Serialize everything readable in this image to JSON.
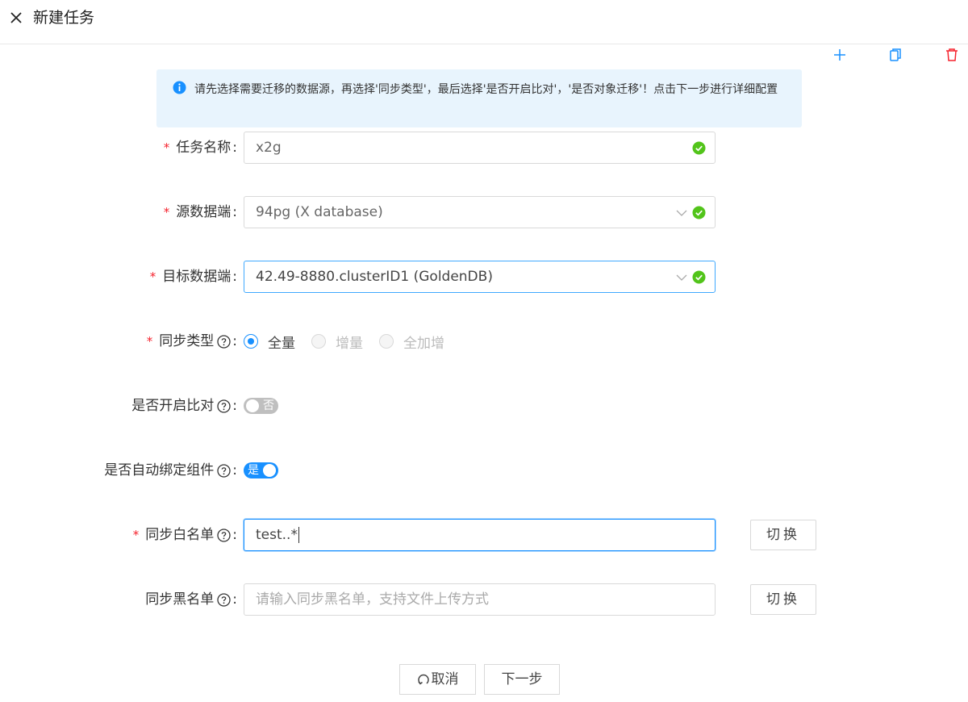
{
  "header": {
    "title": "新建任务"
  },
  "toolbar": {
    "icons": [
      "plus-icon",
      "copy-icon",
      "delete-icon"
    ],
    "delete_color": "#f5222d",
    "accent": "#1890ff"
  },
  "alert": {
    "text": "请先选择需要迁移的数据源，再选择'同步类型'，最后选择'是否开启比对'，'是否对象迁移'！点击下一步进行详细配置"
  },
  "form": {
    "task_name": {
      "label": "任务名称",
      "value": "x2g"
    },
    "source": {
      "label": "源数据端",
      "value": "94pg (X database)"
    },
    "target": {
      "label": "目标数据端",
      "value": "42.49-8880.clusterID1 (GoldenDB)"
    },
    "sync_type": {
      "label": "同步类型",
      "options": [
        "全量",
        "增量",
        "全加增"
      ],
      "selected": "全量"
    },
    "compare": {
      "label": "是否开启比对",
      "switch_text": "否",
      "on": false
    },
    "auto_bind": {
      "label": "是否自动绑定组件",
      "switch_text": "是",
      "on": true
    },
    "whitelist": {
      "label": "同步白名单",
      "value": "test..*",
      "switch_button": "切换"
    },
    "blacklist": {
      "label": "同步黑名单",
      "placeholder": "请输入同步黑名单，支持文件上传方式",
      "switch_button": "切换"
    },
    "colon": ":"
  },
  "footer": {
    "cancel": "取消",
    "next": "下一步"
  }
}
